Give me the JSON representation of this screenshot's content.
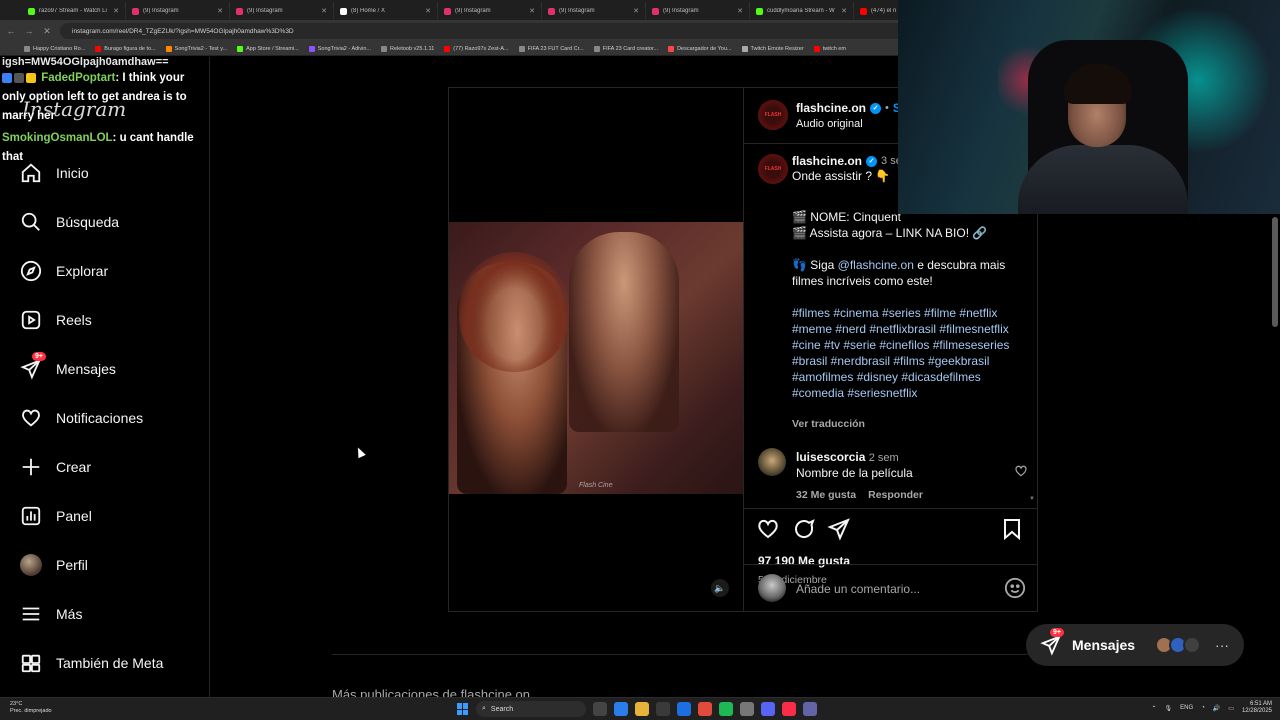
{
  "browser": {
    "tabs": [
      {
        "label": "razo97 Stream - Watch Li",
        "color": "#53fc18"
      },
      {
        "label": "(9) Instagram",
        "color": "#e1306c"
      },
      {
        "label": "(9) Instagram",
        "color": "#e1306c"
      },
      {
        "label": "(8) Home / X",
        "color": "#ffffff"
      },
      {
        "label": "(9) Instagram",
        "color": "#e1306c"
      },
      {
        "label": "(9) Instagram",
        "color": "#e1306c"
      },
      {
        "label": "(9) Instagram",
        "color": "#e1306c"
      },
      {
        "label": "cuddlymoana Stream - W",
        "color": "#53fc18"
      },
      {
        "label": "(474) el n",
        "color": "#ff0000"
      }
    ],
    "url": "instagram.com/reel/DR4_TZgEZUk/?igsh=MW54OGlpajh0amdhaw%3D%3D",
    "bookmarks": [
      {
        "label": "Happy Cristiano Ro...",
        "color": "#888888"
      },
      {
        "label": "Burago figura de to...",
        "color": "#ff0000"
      },
      {
        "label": "SongTrivia2 - Test y...",
        "color": "#ff8800"
      },
      {
        "label": "App Store / Streami...",
        "color": "#53fc18"
      },
      {
        "label": "SongTrivia2 - Adivin...",
        "color": "#8855ff"
      },
      {
        "label": "Reletoob v25.1.11",
        "color": "#888888"
      },
      {
        "label": "(77) Razo97s Zest-A...",
        "color": "#ff0000"
      },
      {
        "label": "FIFA 23 FUT Card Cr...",
        "color": "#888888"
      },
      {
        "label": "FIFA 23 Card creator...",
        "color": "#888888"
      },
      {
        "label": "Descargador de You...",
        "color": "#ff4444"
      },
      {
        "label": "Twitch Emote Resizer",
        "color": "#aaaaaa"
      },
      {
        "label": "twitch em",
        "color": "#ff0000"
      }
    ]
  },
  "chat": {
    "top_line": "igsh=MW54OGlpajh0amdhaw==",
    "messages": [
      {
        "user": "FadedPoptart",
        "text": ": I think your only option left to get andrea is to marry her"
      },
      {
        "user": "SmokingOsmanLOL",
        "text": ": u cant handle that"
      }
    ]
  },
  "sidebar": {
    "logo": "Instagram",
    "items": [
      {
        "label": "Inicio",
        "icon": "home-icon"
      },
      {
        "label": "Búsqueda",
        "icon": "search-icon"
      },
      {
        "label": "Explorar",
        "icon": "compass-icon"
      },
      {
        "label": "Reels",
        "icon": "reels-icon"
      },
      {
        "label": "Mensajes",
        "icon": "messenger-icon",
        "badge": "9+"
      },
      {
        "label": "Notificaciones",
        "icon": "heart-icon"
      },
      {
        "label": "Crear",
        "icon": "plus-icon"
      },
      {
        "label": "Panel",
        "icon": "chart-icon"
      },
      {
        "label": "Perfil",
        "icon": "avatar"
      },
      {
        "label": "Más",
        "icon": "menu-icon"
      },
      {
        "label": "También de Meta",
        "icon": "meta-icon"
      }
    ]
  },
  "reel": {
    "watermark": "Flash Cine",
    "mute_icon": "speaker-icon"
  },
  "post": {
    "author": "flashcine.on",
    "follow_label": "Se",
    "audio": "Audio original",
    "caption_author": "flashcine.on",
    "caption_time": "3 se",
    "caption_lines": [
      "Onde assistir ?",
      "🎬 NOME: Cinquent",
      "🎬 Assista agora – LINK NA BIO! 🔗",
      "👣 Siga @flashcine.on e descubra mais filmes incríveis como este!"
    ],
    "caption_line1": "Onde assistir ? 👇",
    "caption_name": "NOME: Cinquent",
    "caption_watch": "Assista agora – LINK NA BIO!",
    "caption_follow_prefix": "Siga ",
    "caption_follow_handle": "@flashcine.on",
    "caption_follow_suffix": " e descubra mais filmes incríveis como este!",
    "hashtags": "#filmes #cinema #series #filme #netflix #meme #nerd #netflixbrasil #filmesnetflix #cine #tv #serie #cinefilos #filmeseseries #brasil #nerdbrasil #films #geekbrasil #amofilmes #disney #dicasdefilmes #comedia #seriesnetflix",
    "see_translation": "Ver traducción",
    "comment": {
      "user": "luisescorcia",
      "time": "2 sem",
      "text": "Nombre de la película",
      "likes": "32 Me gusta",
      "reply": "Responder"
    },
    "likes": "97 190 Me gusta",
    "date": "5 de diciembre",
    "comment_placeholder": "Añade un comentario..."
  },
  "more_from": "Más publicaciones de flashcine.on",
  "messages_pill": {
    "label": "Mensajes",
    "badge": "9+"
  },
  "taskbar": {
    "weather_temp": "23°C",
    "weather_desc": "Prec. dimprejado",
    "search": "Search",
    "lang": "ENG",
    "time": "6:51 AM",
    "date": "12/28/2025"
  }
}
